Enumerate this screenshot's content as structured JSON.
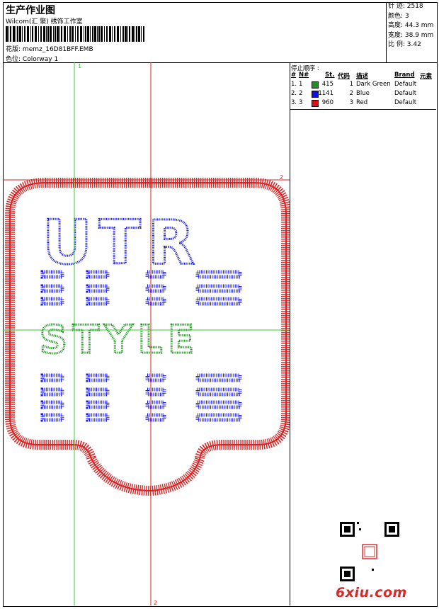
{
  "header": {
    "title": "生产作业图",
    "company": "Wilcom(汇 聚) 绣饰工作室",
    "file_label": "花版:",
    "file_name": "memz_16D81BFF.EMB",
    "colorway_label": "色位:",
    "colorway_name": "Colorway 1"
  },
  "stats": {
    "stitches": "针 迹: 2518",
    "colors": "颜色: 3",
    "height": "高度: 44.3 mm",
    "width": "宽度: 38.9 mm",
    "scale": "比 例: 3.42"
  },
  "stop_sequence": {
    "title": "停止顺序 :",
    "headers": [
      "#",
      "N#",
      "St.",
      "代码",
      "描述",
      "Brand",
      "元素"
    ],
    "rows": [
      {
        "index": "1.",
        "n": "1",
        "color": "#1f8f1f",
        "stitches": "415",
        "code": "1",
        "description": "Dark Green",
        "brand": "Default"
      },
      {
        "index": "2.",
        "n": "2",
        "color": "#1010e0",
        "stitches": "1141",
        "code": "2",
        "description": "Blue",
        "brand": "Default"
      },
      {
        "index": "3.",
        "n": "3",
        "color": "#e01010",
        "stitches": "960",
        "code": "3",
        "description": "Red",
        "brand": "Default"
      }
    ]
  },
  "design": {
    "logo_text": "UTR",
    "sub_text": "STYLE",
    "guide_labels": [
      "1",
      "2",
      "2"
    ],
    "colors": {
      "outline": "#e02020",
      "letters": "#1a1ae0",
      "style": "#1f9a1f",
      "guide_green": "#33cc33",
      "guide_red": "#dd2222"
    }
  },
  "watermark": "6xiu.com"
}
